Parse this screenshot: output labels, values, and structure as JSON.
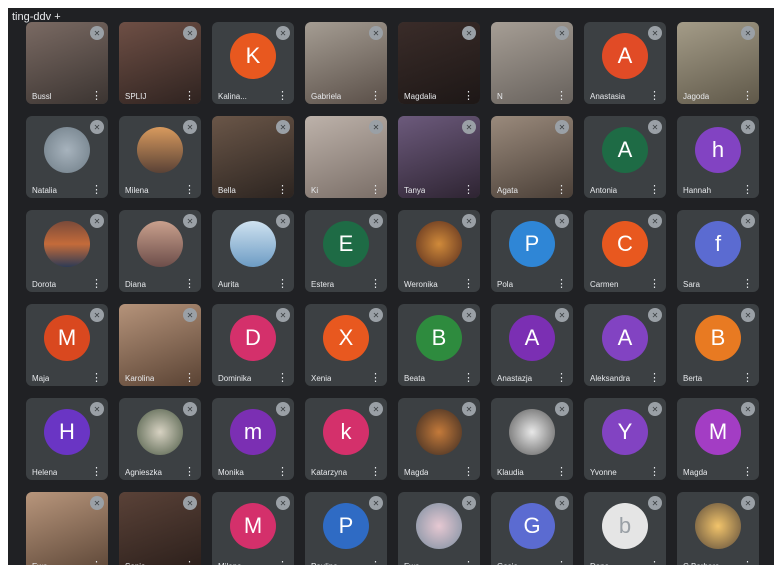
{
  "window": {
    "title": "ting-ddv +"
  },
  "tiles": [
    {
      "name": "Bussl",
      "type": "video",
      "bg": "linear-gradient(160deg,#7a6a63,#3b3431)"
    },
    {
      "name": "SPLIJ",
      "type": "video",
      "bg": "linear-gradient(160deg,#6e4f45,#2f2320)"
    },
    {
      "name": "Kalina...",
      "type": "initial",
      "letter": "K",
      "color": "#e8581f"
    },
    {
      "name": "Gabriela",
      "type": "video",
      "bg": "linear-gradient(160deg,#a59d93,#5a4f48)"
    },
    {
      "name": "Magdalia",
      "type": "video",
      "bg": "linear-gradient(160deg,#3a2c29,#1d1716)"
    },
    {
      "name": "N",
      "type": "video",
      "bg": "linear-gradient(160deg,#a69e95,#67615c)"
    },
    {
      "name": "Anastasia",
      "type": "initial",
      "letter": "A",
      "color": "#e14b26"
    },
    {
      "name": "Jagoda",
      "type": "video",
      "bg": "linear-gradient(160deg,#a49c88,#5f5849)"
    },
    {
      "name": "Natalia",
      "type": "photo",
      "bg": "radial-gradient(circle,#a7b3bd,#6e7c86)"
    },
    {
      "name": "Milena",
      "type": "photo",
      "bg": "linear-gradient(180deg,#d89a5e,#5a4236)"
    },
    {
      "name": "Bella",
      "type": "video",
      "bg": "linear-gradient(160deg,#6a5648,#2c2420)"
    },
    {
      "name": "Ki",
      "type": "video",
      "bg": "linear-gradient(160deg,#bdb2aa,#7a6e67)"
    },
    {
      "name": "Tanya",
      "type": "video",
      "bg": "linear-gradient(160deg,#6c5a7c,#2e2432)"
    },
    {
      "name": "Agata",
      "type": "video",
      "bg": "linear-gradient(160deg,#9a8a7c,#4a3f37)"
    },
    {
      "name": "Antonia",
      "type": "initial",
      "letter": "A",
      "color": "#1e6b45"
    },
    {
      "name": "Hannah",
      "type": "initial",
      "letter": "h",
      "color": "#8243c2"
    },
    {
      "name": "Dorota",
      "type": "photo",
      "bg": "linear-gradient(180deg,#7a4a3a,#c46b3a,#2e3b55)"
    },
    {
      "name": "Diana",
      "type": "photo",
      "bg": "linear-gradient(180deg,#c9a08d,#6d4e4a)"
    },
    {
      "name": "Aurita",
      "type": "photo",
      "bg": "linear-gradient(180deg,#cfe2f0,#6d9cc4)"
    },
    {
      "name": "Estera",
      "type": "initial",
      "letter": "E",
      "color": "#1e6b45"
    },
    {
      "name": "Weronika",
      "type": "photo",
      "bg": "radial-gradient(circle,#d08a3a,#5a2e1e)"
    },
    {
      "name": "Pola",
      "type": "initial",
      "letter": "P",
      "color": "#2f86d6"
    },
    {
      "name": "Carmen",
      "type": "initial",
      "letter": "C",
      "color": "#e8581f"
    },
    {
      "name": "Sara",
      "type": "initial",
      "letter": "f",
      "color": "#5b6bd1"
    },
    {
      "name": "Maja",
      "type": "initial",
      "letter": "M",
      "color": "#d9481f"
    },
    {
      "name": "Karolina",
      "type": "video",
      "bg": "linear-gradient(160deg,#b5937a,#5a4334)"
    },
    {
      "name": "Dominika",
      "type": "initial",
      "letter": "D",
      "color": "#d4306b"
    },
    {
      "name": "Xenia",
      "type": "initial",
      "letter": "X",
      "color": "#e8581f"
    },
    {
      "name": "Beata",
      "type": "initial",
      "letter": "B",
      "color": "#2e8b3e"
    },
    {
      "name": "Anastazja",
      "type": "initial",
      "letter": "A",
      "color": "#7b2fb3"
    },
    {
      "name": "Aleksandra",
      "type": "initial",
      "letter": "A",
      "color": "#8243c2"
    },
    {
      "name": "Berta",
      "type": "initial",
      "letter": "B",
      "color": "#e87a22"
    },
    {
      "name": "Helena",
      "type": "initial",
      "letter": "H",
      "color": "#6a35c4"
    },
    {
      "name": "Agnieszka",
      "type": "photo",
      "bg": "radial-gradient(circle,#d7d2c2,#4c5a45)"
    },
    {
      "name": "Monika",
      "type": "initial",
      "letter": "m",
      "color": "#7b2fb3"
    },
    {
      "name": "Katarzyna",
      "type": "initial",
      "letter": "k",
      "color": "#d4306b"
    },
    {
      "name": "Magda",
      "type": "photo",
      "bg": "radial-gradient(circle,#c47a3a,#3a2a22)"
    },
    {
      "name": "Klaudia",
      "type": "photo",
      "bg": "radial-gradient(circle,#e8e8e8,#5a5a5a)"
    },
    {
      "name": "Yvonne",
      "type": "initial",
      "letter": "Y",
      "color": "#8243c2"
    },
    {
      "name": "Magda",
      "type": "initial",
      "letter": "M",
      "color": "#a33dc4"
    },
    {
      "name": "Ewa",
      "type": "video",
      "bg": "linear-gradient(160deg,#b8967c,#5b4536)"
    },
    {
      "name": "Sonia",
      "type": "video",
      "bg": "linear-gradient(160deg,#5a4238,#2a1e1a)"
    },
    {
      "name": "Milena",
      "type": "initial",
      "letter": "M",
      "color": "#d4306b"
    },
    {
      "name": "Paulina",
      "type": "initial",
      "letter": "P",
      "color": "#2f6bc4"
    },
    {
      "name": "Ewa",
      "type": "photo",
      "bg": "radial-gradient(circle,#e6c8d2,#7b8ea0)"
    },
    {
      "name": "Gosia",
      "type": "initial",
      "letter": "G",
      "color": "#5b6bd1"
    },
    {
      "name": "Dana",
      "type": "initial",
      "letter": "b",
      "color": "#e5e5e5"
    },
    {
      "name": "C Barbara",
      "type": "photo",
      "bg": "radial-gradient(circle,#f2c46b,#5a4a3a)"
    }
  ]
}
